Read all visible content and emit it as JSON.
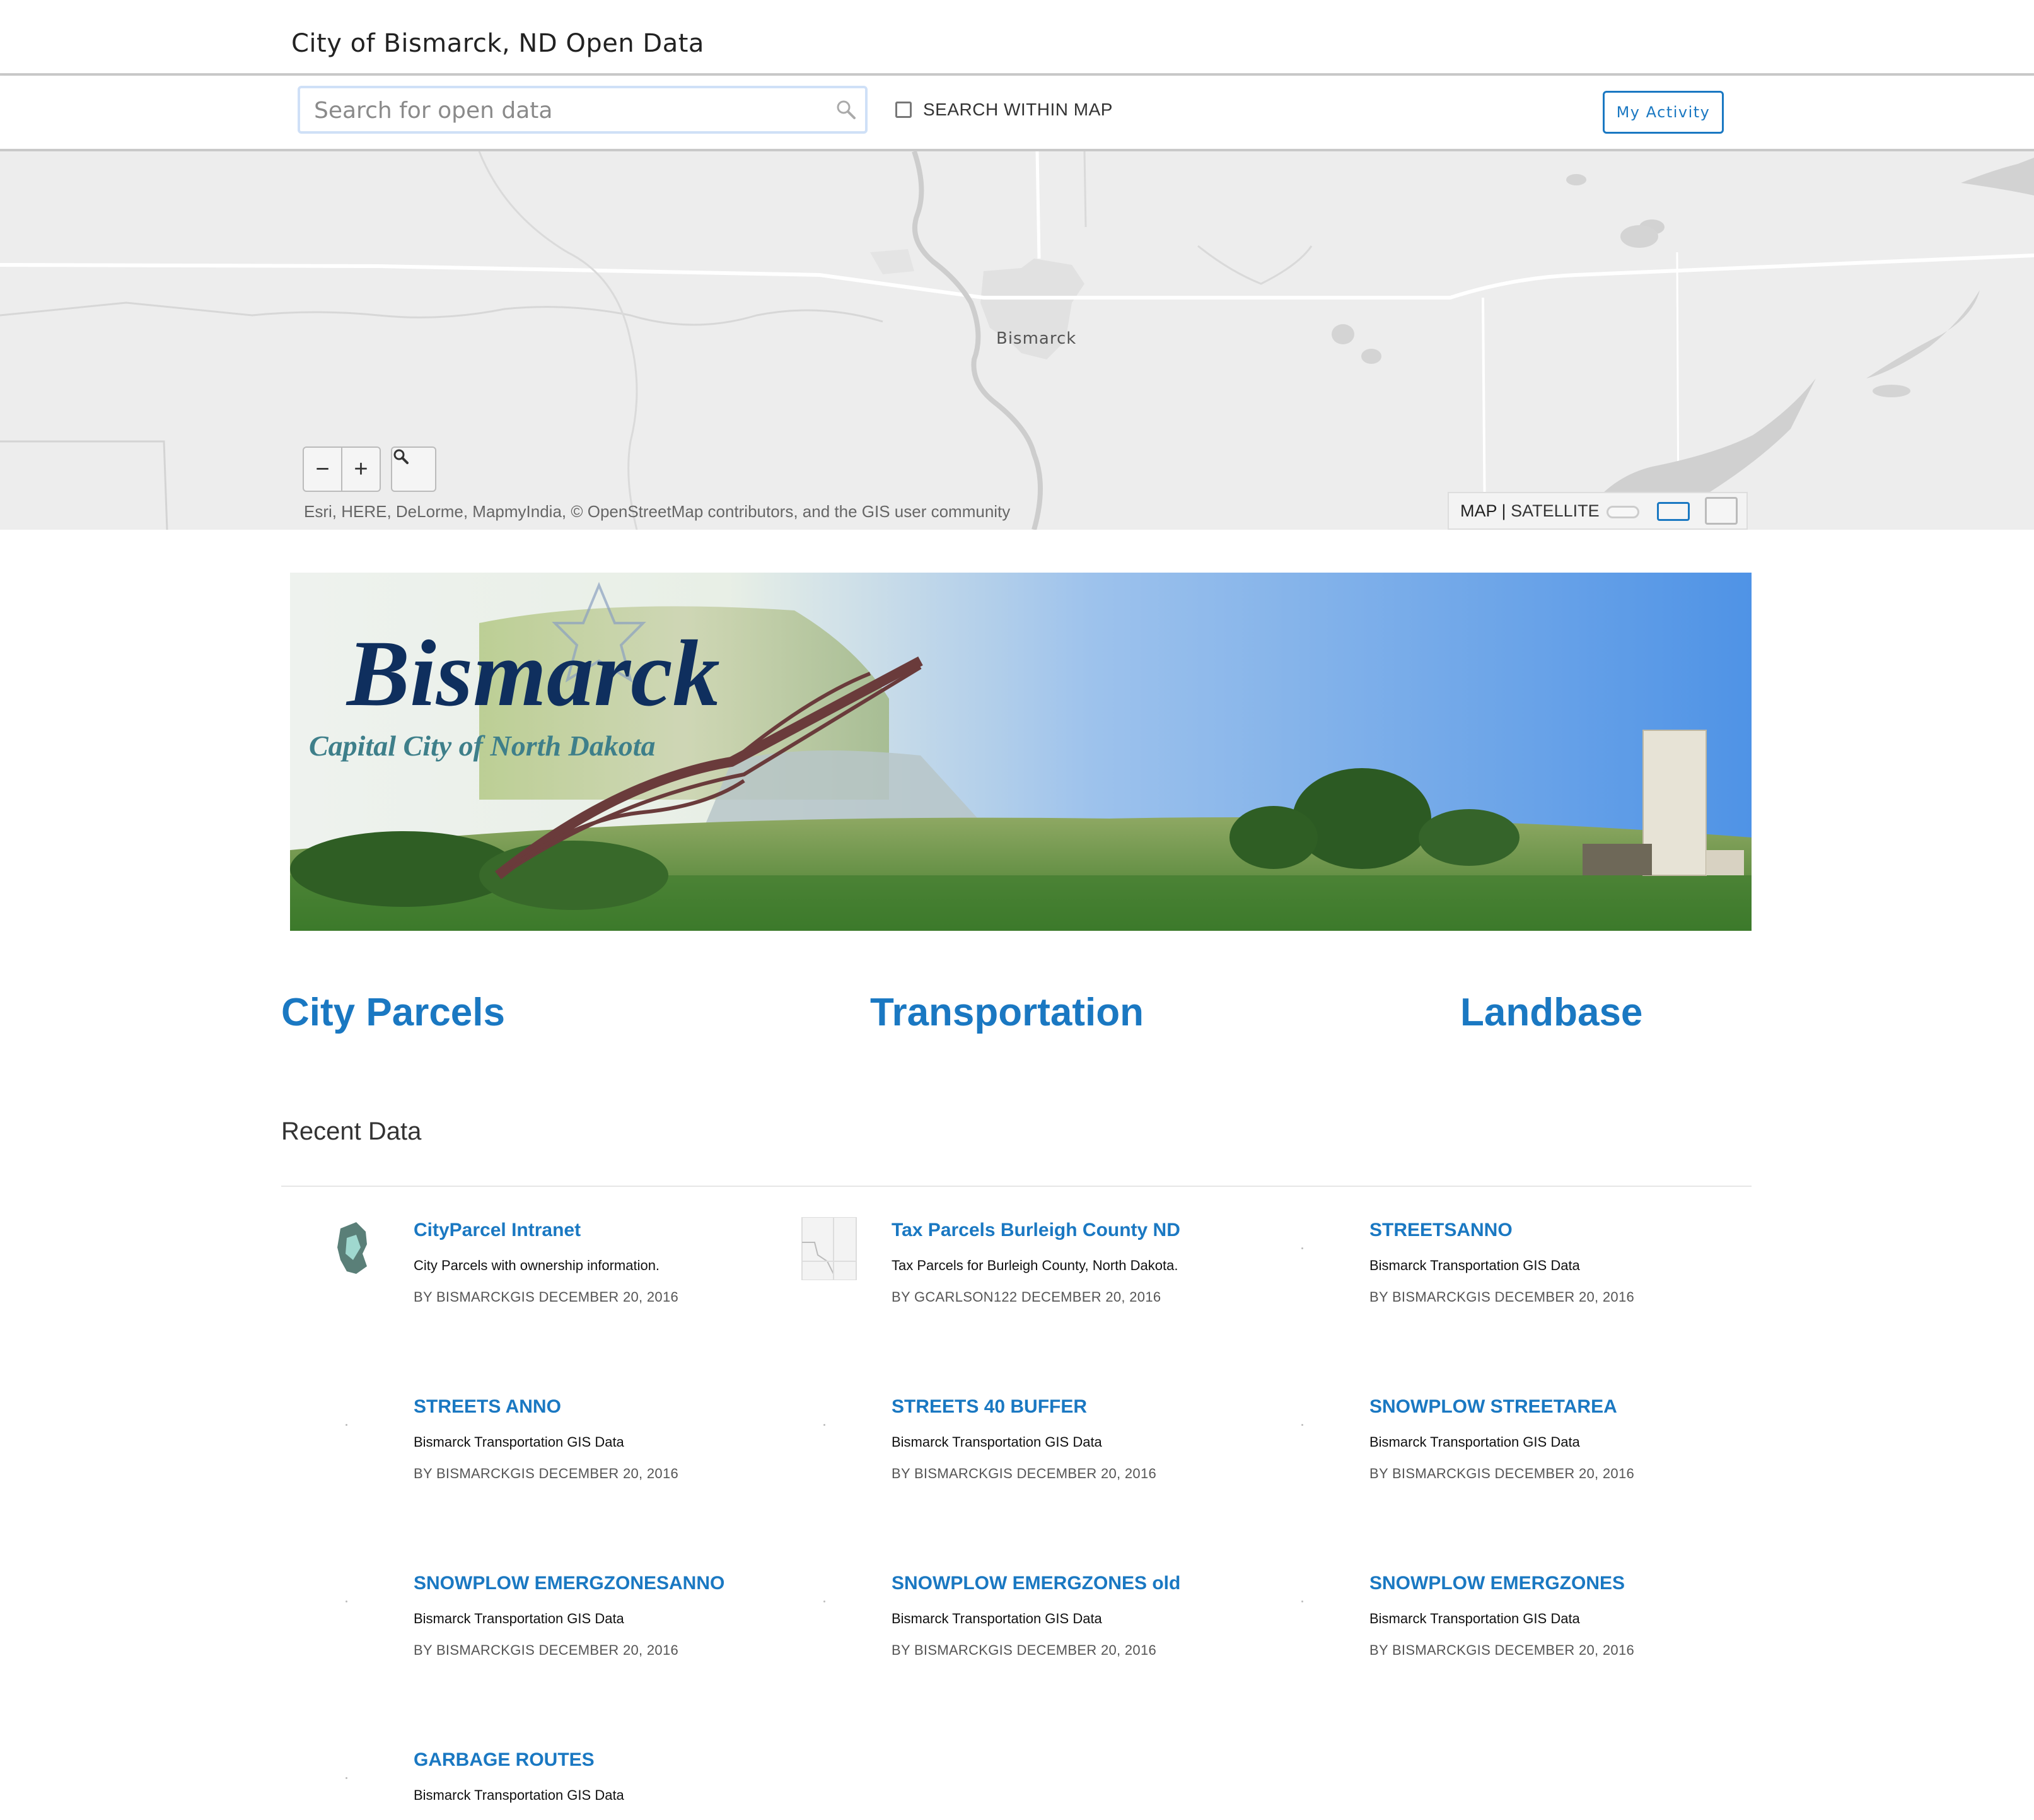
{
  "header": {
    "title": "City of Bismarck, ND Open Data"
  },
  "search": {
    "placeholder": "Search for open data",
    "within_map_label": "SEARCH WITHIN MAP",
    "within_map_checked": false,
    "my_activity_label": "My Activity"
  },
  "map": {
    "place_label": "Bismarck",
    "zoom_out": "−",
    "zoom_in": "+",
    "attribution": "Esri, HERE, DeLorme, MapmyIndia, © OpenStreetMap contributors, and the GIS user community",
    "basemap_map": "MAP",
    "basemap_sep": " | ",
    "basemap_satellite": "SATELLITE"
  },
  "banner": {
    "logo_text": "Bismarck",
    "tagline": "Capital City of North Dakota"
  },
  "categories": [
    "City Parcels",
    "Transportation",
    "Landbase"
  ],
  "recent": {
    "title": "Recent Data",
    "items": [
      {
        "title": "CityParcel Intranet",
        "desc": "City Parcels with ownership information.",
        "meta": "BY BISMARCKGIS DECEMBER 20, 2016"
      },
      {
        "title": "Tax Parcels Burleigh County ND",
        "desc": "Tax Parcels for Burleigh County, North Dakota.",
        "meta": "BY GCARLSON122 DECEMBER 20, 2016"
      },
      {
        "title": "STREETSANNO",
        "desc": "Bismarck Transportation GIS Data",
        "meta": "BY BISMARCKGIS DECEMBER 20, 2016"
      },
      {
        "title": "STREETS ANNO",
        "desc": "Bismarck Transportation GIS Data",
        "meta": "BY BISMARCKGIS DECEMBER 20, 2016"
      },
      {
        "title": "STREETS 40 BUFFER",
        "desc": "Bismarck Transportation GIS Data",
        "meta": "BY BISMARCKGIS DECEMBER 20, 2016"
      },
      {
        "title": "SNOWPLOW STREETAREA",
        "desc": "Bismarck Transportation GIS Data",
        "meta": "BY BISMARCKGIS DECEMBER 20, 2016"
      },
      {
        "title": "SNOWPLOW EMERGZONESANNO",
        "desc": "Bismarck Transportation GIS Data",
        "meta": "BY BISMARCKGIS DECEMBER 20, 2016"
      },
      {
        "title": "SNOWPLOW EMERGZONES old",
        "desc": "Bismarck Transportation GIS Data",
        "meta": "BY BISMARCKGIS DECEMBER 20, 2016"
      },
      {
        "title": "SNOWPLOW EMERGZONES",
        "desc": "Bismarck Transportation GIS Data",
        "meta": "BY BISMARCKGIS DECEMBER 20, 2016"
      },
      {
        "title": "GARBAGE ROUTES",
        "desc": "Bismarck Transportation GIS Data",
        "meta": ""
      }
    ]
  },
  "colors": {
    "link": "#1a78c2",
    "map_bg": "#ededed",
    "sky": "#5c9be0"
  }
}
